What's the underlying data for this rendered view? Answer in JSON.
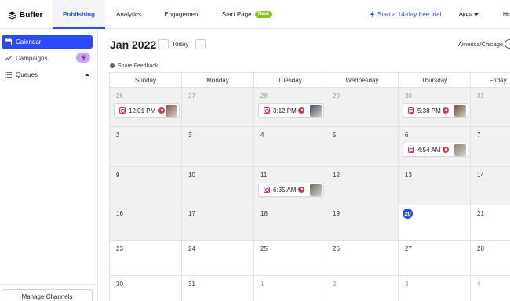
{
  "app": {
    "name": "Buffer"
  },
  "nav": {
    "tabs": [
      {
        "label": "Publishing",
        "active": true
      },
      {
        "label": "Analytics",
        "active": false
      },
      {
        "label": "Engagement",
        "active": false
      },
      {
        "label": "Start Page",
        "active": false,
        "badge": "New!"
      }
    ],
    "trial_link": "Start a 14-day free trial",
    "apps_label": "Apps",
    "help_label": "He"
  },
  "sidebar": {
    "items": [
      {
        "label": "Calendar",
        "icon": "calendar-icon",
        "active": true
      },
      {
        "label": "Campaigns",
        "icon": "trend-icon",
        "badge_icon": "bolt-icon"
      },
      {
        "label": "Queues",
        "icon": "list-icon"
      }
    ],
    "manage_button": "Manage Channels"
  },
  "header": {
    "month": "Jan 2022",
    "today_label": "Today",
    "prev_icon": "←",
    "next_icon": "→",
    "timezone": "America/Chicago",
    "feedback": "Share Feedback"
  },
  "calendar": {
    "days": [
      "Sunday",
      "Monday",
      "Tuesday",
      "Wednesday",
      "Thursday",
      "Friday"
    ],
    "today": "20",
    "weeks": [
      [
        "26",
        "27",
        "28",
        "29",
        "30",
        "31"
      ],
      [
        "2",
        "3",
        "4",
        "5",
        "6",
        "7"
      ],
      [
        "9",
        "10",
        "11",
        "12",
        "13",
        "14"
      ],
      [
        "16",
        "17",
        "18",
        "19",
        "20",
        "21"
      ],
      [
        "23",
        "24",
        "25",
        "26",
        "27",
        "28"
      ],
      [
        "30",
        "31",
        "1",
        "2",
        "3",
        "4"
      ]
    ],
    "posts": [
      {
        "time": "12:01 PM",
        "channel": "instagram",
        "thumb_color": "#7a5a48"
      },
      {
        "time": "3:12 PM",
        "channel": "instagram",
        "thumb_color": "#3d4f63"
      },
      {
        "time": "5:38 PM",
        "channel": "instagram",
        "thumb_color": "#6d5038"
      },
      {
        "time": "4:54 AM",
        "channel": "instagram",
        "thumb_color": "#8a8178"
      },
      {
        "time": "6:35 AM",
        "channel": "instagram",
        "thumb_color": "#6f6a66"
      }
    ]
  },
  "colors": {
    "accent": "#2c4bff",
    "new_badge": "#87c221",
    "instagram": "#d62976",
    "alert": "#e0364a",
    "past_cell": "#f1f1f1"
  }
}
